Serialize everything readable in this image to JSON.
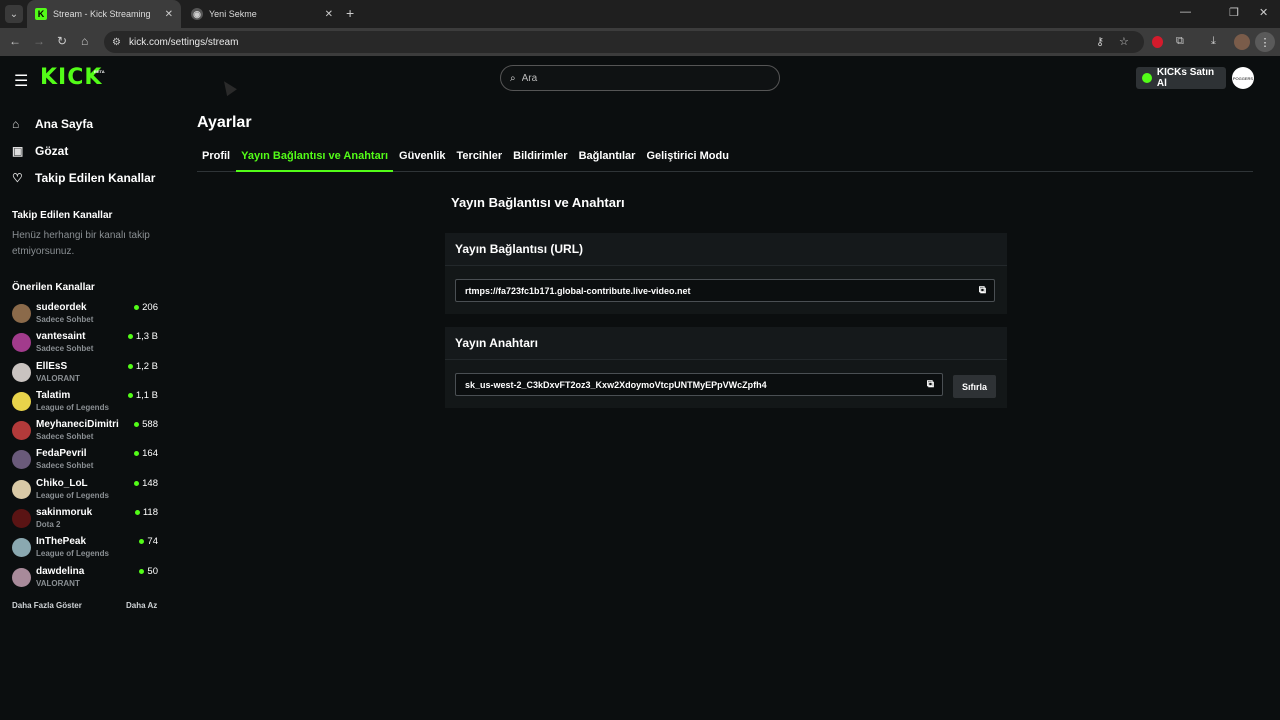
{
  "browser": {
    "tabs": [
      {
        "title": "Stream - Kick Streaming",
        "active": true
      },
      {
        "title": "Yeni Sekme",
        "active": false
      }
    ],
    "url": "kick.com/settings/stream"
  },
  "header": {
    "logo": "KICK",
    "logo_badge": "BETA",
    "search_placeholder": "Ara",
    "kicks_button": "KICKs Satın Al",
    "avatar_text": "POGGERS"
  },
  "sidebar": {
    "nav": [
      {
        "label": "Ana Sayfa",
        "icon": "home-icon"
      },
      {
        "label": "Gözat",
        "icon": "browse-icon"
      },
      {
        "label": "Takip Edilen Kanallar",
        "icon": "heart-icon"
      }
    ],
    "followed_title": "Takip Edilen Kanallar",
    "followed_empty": "Henüz herhangi bir kanalı takip etmiyorsunuz.",
    "recommended_title": "Önerilen Kanallar",
    "channels": [
      {
        "name": "sudeordek",
        "category": "Sadece Sohbet",
        "viewers": "206",
        "color": "#8b6a4a"
      },
      {
        "name": "vantesaint",
        "category": "Sadece Sohbet",
        "viewers": "1,3 B",
        "color": "#a23b8c"
      },
      {
        "name": "EllEsS",
        "category": "VALORANT",
        "viewers": "1,2 B",
        "color": "#c9c3c0"
      },
      {
        "name": "Talatim",
        "category": "League of Legends",
        "viewers": "1,1 B",
        "color": "#e8d34a"
      },
      {
        "name": "MeyhaneciDimitri",
        "category": "Sadece Sohbet",
        "viewers": "588",
        "color": "#b23a3a"
      },
      {
        "name": "FedaPevril",
        "category": "Sadece Sohbet",
        "viewers": "164",
        "color": "#6a5a7a"
      },
      {
        "name": "Chiko_LoL",
        "category": "League of Legends",
        "viewers": "148",
        "color": "#d9c9a6"
      },
      {
        "name": "sakinmoruk",
        "category": "Dota 2",
        "viewers": "118",
        "color": "#5a1414"
      },
      {
        "name": "InThePeak",
        "category": "League of Legends",
        "viewers": "74",
        "color": "#8aa8b0"
      },
      {
        "name": "dawdelina",
        "category": "VALORANT",
        "viewers": "50",
        "color": "#a88a9a"
      }
    ],
    "show_more": "Daha Fazla Göster",
    "show_less": "Daha Az"
  },
  "main": {
    "title": "Ayarlar",
    "tabs": [
      "Profil",
      "Yayın Bağlantısı ve Anahtarı",
      "Güvenlik",
      "Tercihler",
      "Bildirimler",
      "Bağlantılar",
      "Geliştirici Modu"
    ],
    "active_tab": 1,
    "section_title": "Yayın Bağlantısı ve Anahtarı",
    "url_card": {
      "heading": "Yayın Bağlantısı (URL)",
      "value": "rtmps://fa723fc1b171.global-contribute.live-video.net"
    },
    "key_card": {
      "heading": "Yayın Anahtarı",
      "value": "sk_us-west-2_C3kDxvFT2oz3_Kxw2XdoymoVtcpUNTMyEPpVWcZpfh4",
      "reset_label": "Sıfırla"
    }
  },
  "colors": {
    "accent": "#53fc18",
    "background": "#0b0e0f",
    "card": "#131718"
  }
}
